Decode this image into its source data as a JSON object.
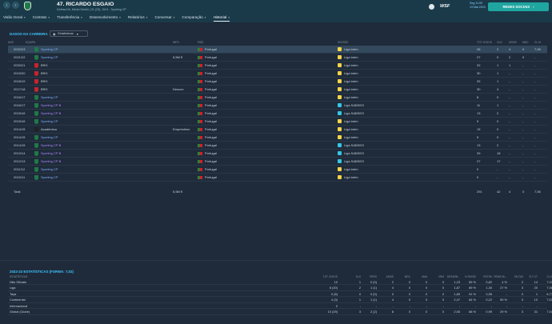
{
  "header": {
    "player_name": "47. RICARDO ESGAIO",
    "player_sub": "Defesa Dir, Médio Direito | 31 (23), 1M € - Sporting CP",
    "season_time": "Seg 11:00\n13 Mai 2023",
    "wsf_label": "WSF",
    "continue_label": "REDES SOCIAIS"
  },
  "nav": {
    "items": [
      {
        "label": "Visão Geral",
        "active": false
      },
      {
        "label": "Contrato",
        "active": false
      },
      {
        "label": "Transferência",
        "active": false
      },
      {
        "label": "Desenvolvimento",
        "active": false
      },
      {
        "label": "Relatórios",
        "active": false
      },
      {
        "label": "Conversar",
        "active": false
      },
      {
        "label": "Comparação",
        "active": false
      },
      {
        "label": "Historial",
        "active": true
      }
    ]
  },
  "career": {
    "title": "DADOS DA CARREIRA",
    "dropdown_label": "Estatísticas",
    "columns": [
      "ANO",
      "EQUIPA",
      "INFO",
      "PAÍS",
      "DIVISÃO",
      "TOT JOGOS",
      "GLS",
      "ASSIS",
      "MDC",
      "CL M"
    ],
    "rows": [
      {
        "year": "2022/23",
        "team": "Sporting CP",
        "info": "",
        "country": "Portugal",
        "division": "Liga betm",
        "apps": "26",
        "gls": "2",
        "ast": "4",
        "mdc": "0",
        "av": "7,06",
        "club": "green",
        "div": "yellow",
        "selected": true
      },
      {
        "year": "2021/22",
        "team": "Sporting CP",
        "info": "5,5M €",
        "country": "Portugal",
        "division": "Liga betm",
        "apps": "27",
        "gls": "0",
        "ast": "2",
        "mdc": "0",
        "av": "-",
        "club": "green",
        "div": "yellow",
        "selected": false
      },
      {
        "year": "2020/21",
        "team": "BRG",
        "info": "",
        "country": "Portugal",
        "division": "Liga betm",
        "apps": "32",
        "gls": "1",
        "ast": "1",
        "mdc": "-",
        "av": "-",
        "club": "red",
        "div": "yellow",
        "selected": false
      },
      {
        "year": "2019/20",
        "team": "BRG",
        "info": "",
        "country": "Portugal",
        "division": "Liga betm",
        "apps": "30",
        "gls": "1",
        "ast": "-",
        "mdc": "-",
        "av": "-",
        "club": "red",
        "div": "yellow",
        "selected": false
      },
      {
        "year": "2018/19",
        "team": "BRG",
        "info": "",
        "country": "Portugal",
        "division": "Liga betm",
        "apps": "25",
        "gls": "1",
        "ast": "-",
        "mdc": "-",
        "av": "-",
        "club": "red",
        "div": "yellow",
        "selected": false
      },
      {
        "year": "2017/18",
        "team": "BRG",
        "info": "Descon",
        "country": "Portugal",
        "division": "Liga betm",
        "apps": "30",
        "gls": "4",
        "ast": "-",
        "mdc": "-",
        "av": "-",
        "club": "red",
        "div": "yellow",
        "selected": false
      },
      {
        "year": "2016/17",
        "team": "Sporting CP",
        "info": "",
        "country": "Portugal",
        "division": "Liga betm",
        "apps": "8",
        "gls": "0",
        "ast": "-",
        "mdc": "-",
        "av": "-",
        "club": "green",
        "div": "yellow",
        "selected": false
      },
      {
        "year": "2016/17",
        "team": "Sporting CP B",
        "info": "",
        "country": "Portugal",
        "division": "Liga SABSEG",
        "apps": "11",
        "gls": "1",
        "ast": "-",
        "mdc": "-",
        "av": "-",
        "club": "green",
        "div": "cyan",
        "selected": false
      },
      {
        "year": "2015/16",
        "team": "Sporting CP B",
        "info": "",
        "country": "Portugal",
        "division": "Liga SABSEG",
        "apps": "13",
        "gls": "2",
        "ast": "-",
        "mdc": "-",
        "av": "-",
        "club": "green",
        "div": "cyan",
        "selected": false
      },
      {
        "year": "2015/16",
        "team": "Sporting CP",
        "info": "",
        "country": "Portugal",
        "division": "Liga betm",
        "apps": "9",
        "gls": "0",
        "ast": "-",
        "mdc": "-",
        "av": "-",
        "club": "green",
        "div": "yellow",
        "selected": false
      },
      {
        "year": "2014/15",
        "team": "Académica",
        "info": "Empréstimo",
        "country": "Portugal",
        "division": "Liga betm",
        "apps": "15",
        "gls": "0",
        "ast": "-",
        "mdc": "-",
        "av": "-",
        "club": "black",
        "div": "yellow",
        "selected": false
      },
      {
        "year": "2014/15",
        "team": "Sporting CP",
        "info": "",
        "country": "Portugal",
        "division": "Liga betm",
        "apps": "5",
        "gls": "0",
        "ast": "-",
        "mdc": "-",
        "av": "-",
        "club": "green",
        "div": "yellow",
        "selected": false
      },
      {
        "year": "2014/15",
        "team": "Sporting CP B",
        "info": "",
        "country": "Portugal",
        "division": "Liga SABSEG",
        "apps": "13",
        "gls": "2",
        "ast": "-",
        "mdc": "-",
        "av": "-",
        "club": "green",
        "div": "cyan",
        "selected": false
      },
      {
        "year": "2013/14",
        "team": "Sporting CP B",
        "info": "",
        "country": "Portugal",
        "division": "Liga SABSEG",
        "apps": "39",
        "gls": "18",
        "ast": "-",
        "mdc": "-",
        "av": "-",
        "club": "green",
        "div": "cyan",
        "selected": false
      },
      {
        "year": "2012/13",
        "team": "Sporting CP B",
        "info": "",
        "country": "Portugal",
        "division": "Liga SABSEG",
        "apps": "27",
        "gls": "17",
        "ast": "-",
        "mdc": "-",
        "av": "-",
        "club": "green",
        "div": "cyan",
        "selected": false
      },
      {
        "year": "2011/12",
        "team": "Sporting CP",
        "info": "",
        "country": "Portugal",
        "division": "Liga betm",
        "apps": "0",
        "gls": "-",
        "ast": "-",
        "mdc": "-",
        "av": "-",
        "club": "green",
        "div": "yellow",
        "selected": false
      },
      {
        "year": "2010/11",
        "team": "Sporting CP",
        "info": "",
        "country": "Portugal",
        "division": "Liga betm",
        "apps": "0",
        "gls": "-",
        "ast": "-",
        "mdc": "-",
        "av": "-",
        "club": "green",
        "div": "yellow",
        "selected": false
      }
    ],
    "total": {
      "label": "Total",
      "info": "5,5M €",
      "apps": "291",
      "gls": "42",
      "ast": "4",
      "mdc": "0",
      "av": "7,06"
    }
  },
  "season_stats": {
    "title": "2022-23 ESTATÍSTICAS (FORMA: 7,02)",
    "columns": [
      "ESTATÍSTICAS",
      "TOT JOGOS",
      "GLS",
      "PERD",
      "ASSIS",
      "MDC",
      "AMA",
      "VRM",
      "DESARM...",
      "% PASSE",
      "RST/90",
      "REMS BL...",
      "FALTAS",
      "FLT CT",
      "CL M"
    ],
    "rows": [
      {
        "label": "Não Oficiais",
        "vals": [
          "10",
          "1",
          "0 (0)",
          "2",
          "0",
          "0",
          "0",
          "1,23",
          "89 %",
          "0,82",
          "4 %",
          "2",
          "14",
          "7,21"
        ]
      },
      {
        "label": "Liga",
        "vals": [
          "6 (20)",
          "2",
          "1 (1)",
          "4",
          "0",
          "0",
          "0",
          "1,87",
          "89 %",
          "1,30",
          "27 %",
          "3",
          "20",
          "7,08"
        ]
      },
      {
        "label": "Taça",
        "vals": [
          "0 (6)",
          "0",
          "0 (0)",
          "0",
          "0",
          "0",
          "0",
          "1,89",
          "91 %",
          "0,95",
          "-",
          "0",
          "1",
          "6,77"
        ]
      },
      {
        "label": "Continental",
        "vals": [
          "4 (3)",
          "1",
          "1 (1)",
          "4",
          "0",
          "0",
          "0",
          "2,47",
          "84 %",
          "0,22",
          "50 %",
          "0",
          "10",
          "7,03"
        ]
      },
      {
        "label": "Internacional",
        "vals": [
          "0",
          "-",
          "-",
          "-",
          "-",
          "-",
          "-",
          "-",
          "-",
          "-",
          "-",
          "-",
          "-",
          "-"
        ]
      },
      {
        "label": "Global (Clube)",
        "vals": [
          "10 (29)",
          "3",
          "2 (2)",
          "8",
          "0",
          "0",
          "0",
          "2,05",
          "88 %",
          "0,99",
          "29 %",
          "3",
          "31",
          "7,04"
        ]
      }
    ]
  },
  "colors": {
    "accent": "#3fc3ff",
    "continue": "#1fa6a0",
    "club_green": "#1f7a4a",
    "club_red": "#c8242c",
    "club_black": "#222222",
    "div_yellow": "#f3d34a",
    "div_cyan": "#39c4e6"
  }
}
